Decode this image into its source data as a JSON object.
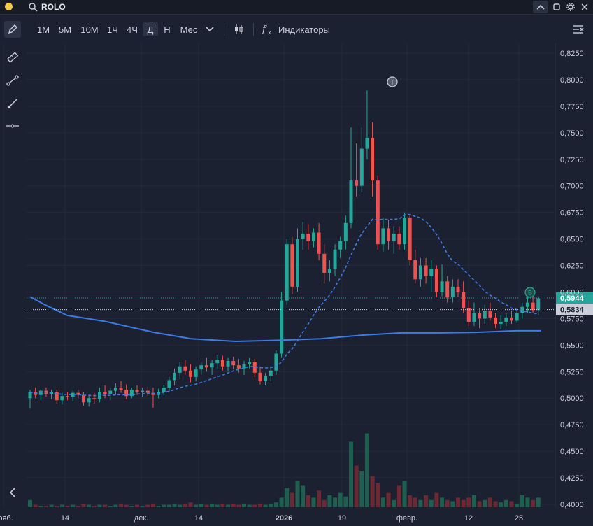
{
  "header": {
    "symbol": "ROLO"
  },
  "toolbar": {
    "intervals": [
      "1М",
      "5М",
      "10М",
      "1Ч",
      "4Ч",
      "Д",
      "Н",
      "Мес"
    ],
    "active_interval": "Д",
    "indicators_label": "Индикаторы"
  },
  "icons": [
    "search-icon",
    "pencil-icon",
    "chevron-down-icon",
    "candles-icon",
    "fx-icon",
    "ruler-icon",
    "trendline-icon",
    "brush-icon",
    "horizontal-line-icon",
    "chevron-left-icon",
    "chevron-up-icon",
    "maximize-icon",
    "gear-icon",
    "close-icon"
  ],
  "colors": {
    "up": "#26a69a",
    "down": "#ef5350",
    "ma_long": "#3d7be6",
    "ma_short": "#3d7be6",
    "price_tag": "#26a69a",
    "ref_tag": "#c9ced8"
  },
  "chart_data": {
    "type": "candlestick",
    "ylim": [
      0.4,
      0.825
    ],
    "y_ticks": [
      "0,8250",
      "0,8000",
      "0,7750",
      "0,7500",
      "0,7250",
      "0,7000",
      "0,6750",
      "0,6500",
      "0,6250",
      "0,6000",
      "0,5750",
      "0,5500",
      "0,5250",
      "0,5000",
      "0,4750",
      "0,4500",
      "0,4250",
      "0,4000"
    ],
    "x_ticks": [
      "нояб.",
      "14",
      "дек.",
      "14",
      "2026",
      "19",
      "февр.",
      "12",
      "25"
    ],
    "last_price": "0,5944",
    "ref_price": "0,5834",
    "markers": [
      "T",
      "B"
    ],
    "candles": [
      [
        0.5,
        0.508,
        0.49,
        0.506
      ],
      [
        0.506,
        0.51,
        0.5,
        0.503
      ],
      [
        0.503,
        0.508,
        0.498,
        0.507
      ],
      [
        0.507,
        0.51,
        0.501,
        0.504
      ],
      [
        0.504,
        0.508,
        0.499,
        0.506
      ],
      [
        0.506,
        0.508,
        0.495,
        0.498
      ],
      [
        0.498,
        0.505,
        0.494,
        0.502
      ],
      [
        0.502,
        0.506,
        0.498,
        0.501
      ],
      [
        0.501,
        0.507,
        0.497,
        0.505
      ],
      [
        0.505,
        0.508,
        0.5,
        0.503
      ],
      [
        0.503,
        0.506,
        0.493,
        0.496
      ],
      [
        0.496,
        0.502,
        0.492,
        0.5
      ],
      [
        0.5,
        0.505,
        0.495,
        0.499
      ],
      [
        0.499,
        0.51,
        0.496,
        0.506
      ],
      [
        0.506,
        0.512,
        0.5,
        0.504
      ],
      [
        0.504,
        0.51,
        0.498,
        0.507
      ],
      [
        0.507,
        0.514,
        0.503,
        0.51
      ],
      [
        0.51,
        0.516,
        0.505,
        0.508
      ],
      [
        0.508,
        0.513,
        0.499,
        0.502
      ],
      [
        0.502,
        0.51,
        0.5,
        0.508
      ],
      [
        0.508,
        0.512,
        0.503,
        0.506
      ],
      [
        0.506,
        0.51,
        0.501,
        0.507
      ],
      [
        0.507,
        0.511,
        0.502,
        0.505
      ],
      [
        0.505,
        0.51,
        0.491,
        0.503
      ],
      [
        0.503,
        0.509,
        0.5,
        0.506
      ],
      [
        0.506,
        0.512,
        0.503,
        0.51
      ],
      [
        0.51,
        0.52,
        0.506,
        0.517
      ],
      [
        0.517,
        0.528,
        0.512,
        0.524
      ],
      [
        0.524,
        0.534,
        0.518,
        0.53
      ],
      [
        0.53,
        0.536,
        0.522,
        0.526
      ],
      [
        0.526,
        0.532,
        0.515,
        0.52
      ],
      [
        0.52,
        0.53,
        0.516,
        0.527
      ],
      [
        0.527,
        0.534,
        0.522,
        0.531
      ],
      [
        0.531,
        0.538,
        0.525,
        0.529
      ],
      [
        0.529,
        0.536,
        0.522,
        0.533
      ],
      [
        0.533,
        0.541,
        0.528,
        0.536
      ],
      [
        0.536,
        0.54,
        0.526,
        0.53
      ],
      [
        0.53,
        0.538,
        0.525,
        0.535
      ],
      [
        0.535,
        0.539,
        0.527,
        0.531
      ],
      [
        0.531,
        0.537,
        0.524,
        0.528
      ],
      [
        0.528,
        0.535,
        0.522,
        0.532
      ],
      [
        0.532,
        0.538,
        0.528,
        0.534
      ],
      [
        0.534,
        0.537,
        0.52,
        0.524
      ],
      [
        0.524,
        0.53,
        0.513,
        0.516
      ],
      [
        0.516,
        0.524,
        0.512,
        0.521
      ],
      [
        0.521,
        0.53,
        0.516,
        0.526
      ],
      [
        0.526,
        0.545,
        0.522,
        0.542
      ],
      [
        0.542,
        0.6,
        0.538,
        0.592
      ],
      [
        0.592,
        0.65,
        0.588,
        0.645
      ],
      [
        0.645,
        0.652,
        0.598,
        0.605
      ],
      [
        0.605,
        0.66,
        0.6,
        0.65
      ],
      [
        0.65,
        0.666,
        0.64,
        0.655
      ],
      [
        0.655,
        0.664,
        0.64,
        0.648
      ],
      [
        0.648,
        0.66,
        0.642,
        0.656
      ],
      [
        0.656,
        0.665,
        0.63,
        0.636
      ],
      [
        0.636,
        0.645,
        0.608,
        0.618
      ],
      [
        0.618,
        0.63,
        0.61,
        0.622
      ],
      [
        0.622,
        0.645,
        0.615,
        0.64
      ],
      [
        0.64,
        0.652,
        0.632,
        0.648
      ],
      [
        0.648,
        0.672,
        0.64,
        0.665
      ],
      [
        0.665,
        0.755,
        0.66,
        0.705
      ],
      [
        0.705,
        0.74,
        0.69,
        0.7
      ],
      [
        0.7,
        0.755,
        0.694,
        0.735
      ],
      [
        0.735,
        0.79,
        0.725,
        0.745
      ],
      [
        0.745,
        0.76,
        0.69,
        0.705
      ],
      [
        0.705,
        0.71,
        0.64,
        0.645
      ],
      [
        0.645,
        0.67,
        0.638,
        0.66
      ],
      [
        0.66,
        0.668,
        0.64,
        0.648
      ],
      [
        0.648,
        0.662,
        0.636,
        0.655
      ],
      [
        0.655,
        0.662,
        0.64,
        0.645
      ],
      [
        0.645,
        0.675,
        0.64,
        0.67
      ],
      [
        0.67,
        0.672,
        0.625,
        0.63
      ],
      [
        0.63,
        0.64,
        0.608,
        0.612
      ],
      [
        0.612,
        0.632,
        0.605,
        0.625
      ],
      [
        0.625,
        0.632,
        0.608,
        0.615
      ],
      [
        0.615,
        0.63,
        0.6,
        0.622
      ],
      [
        0.622,
        0.625,
        0.595,
        0.6
      ],
      [
        0.6,
        0.626,
        0.596,
        0.61
      ],
      [
        0.61,
        0.615,
        0.59,
        0.595
      ],
      [
        0.595,
        0.612,
        0.59,
        0.605
      ],
      [
        0.605,
        0.612,
        0.595,
        0.6
      ],
      [
        0.6,
        0.61,
        0.58,
        0.585
      ],
      [
        0.585,
        0.592,
        0.568,
        0.572
      ],
      [
        0.572,
        0.59,
        0.568,
        0.58
      ],
      [
        0.58,
        0.585,
        0.566,
        0.575
      ],
      [
        0.575,
        0.588,
        0.57,
        0.582
      ],
      [
        0.582,
        0.59,
        0.573,
        0.576
      ],
      [
        0.576,
        0.58,
        0.566,
        0.57
      ],
      [
        0.57,
        0.578,
        0.565,
        0.572
      ],
      [
        0.572,
        0.58,
        0.568,
        0.576
      ],
      [
        0.576,
        0.582,
        0.57,
        0.573
      ],
      [
        0.573,
        0.584,
        0.571,
        0.58
      ],
      [
        0.58,
        0.59,
        0.575,
        0.586
      ],
      [
        0.586,
        0.596,
        0.58,
        0.59
      ],
      [
        0.59,
        0.598,
        0.58,
        0.583
      ],
      [
        0.583,
        0.596,
        0.578,
        0.594
      ]
    ],
    "volumes": [
      6,
      2,
      1,
      1,
      2,
      1,
      2,
      1,
      2,
      1,
      3,
      2,
      1,
      2,
      2,
      1,
      2,
      3,
      2,
      1,
      2,
      1,
      2,
      3,
      1,
      2,
      2,
      3,
      2,
      3,
      4,
      2,
      3,
      2,
      3,
      2,
      3,
      2,
      3,
      2,
      3,
      2,
      2,
      3,
      2,
      3,
      4,
      8,
      16,
      12,
      22,
      18,
      10,
      8,
      14,
      6,
      10,
      8,
      12,
      9,
      55,
      35,
      30,
      62,
      26,
      20,
      8,
      12,
      6,
      18,
      22,
      10,
      8,
      6,
      10,
      6,
      12,
      8,
      6,
      5,
      8,
      6,
      8,
      10,
      5,
      6,
      8,
      5,
      4,
      6,
      5,
      3,
      10,
      8,
      6,
      8
    ]
  }
}
